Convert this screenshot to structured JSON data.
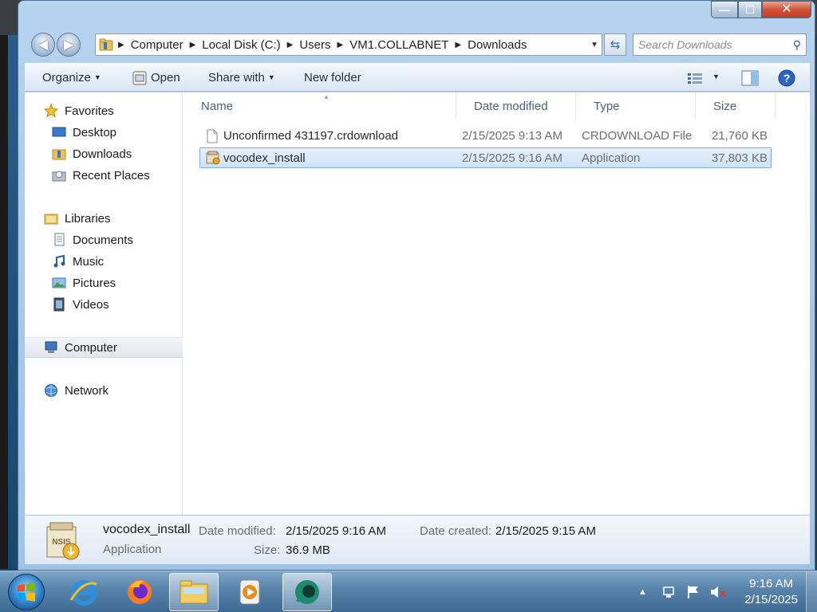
{
  "window": {
    "caption_buttons": {
      "minimize": "—",
      "maximize": "☐",
      "close": "✕"
    }
  },
  "address_bar": {
    "crumbs": [
      "Computer",
      "Local Disk (C:)",
      "Users",
      "VM1.COLLABNET",
      "Downloads"
    ]
  },
  "search": {
    "placeholder": "Search Downloads"
  },
  "toolbar": {
    "organize": "Organize",
    "open": "Open",
    "share_with": "Share with",
    "new_folder": "New folder"
  },
  "nav_pane": {
    "favorites": "Favorites",
    "desktop": "Desktop",
    "downloads": "Downloads",
    "recent_places": "Recent Places",
    "libraries": "Libraries",
    "documents": "Documents",
    "music": "Music",
    "pictures": "Pictures",
    "videos": "Videos",
    "computer": "Computer",
    "network": "Network"
  },
  "columns": {
    "name": "Name",
    "date_modified": "Date modified",
    "type": "Type",
    "size": "Size"
  },
  "files": [
    {
      "name": "Unconfirmed 431197.crdownload",
      "date": "2/15/2025 9:13 AM",
      "type": "CRDOWNLOAD File",
      "size": "21,760 KB",
      "icon": "blank-file-icon"
    },
    {
      "name": "vocodex_install",
      "date": "2/15/2025 9:16 AM",
      "type": "Application",
      "size": "37,803 KB",
      "icon": "installer-icon",
      "selected": true
    }
  ],
  "details": {
    "name": "vocodex_install",
    "type": "Application",
    "date_modified_label": "Date modified:",
    "date_modified": "2/15/2025 9:16 AM",
    "date_created_label": "Date created:",
    "date_created": "2/15/2025 9:15 AM",
    "size_label": "Size:",
    "size": "36.9 MB"
  },
  "taskbar": {
    "time": "9:16 AM",
    "date": "2/15/2025"
  },
  "colors": {
    "selection": "#cde3f8",
    "selection_border": "#84acdd",
    "taskbar": "#3d6a93",
    "close_button": "#c33e22"
  }
}
